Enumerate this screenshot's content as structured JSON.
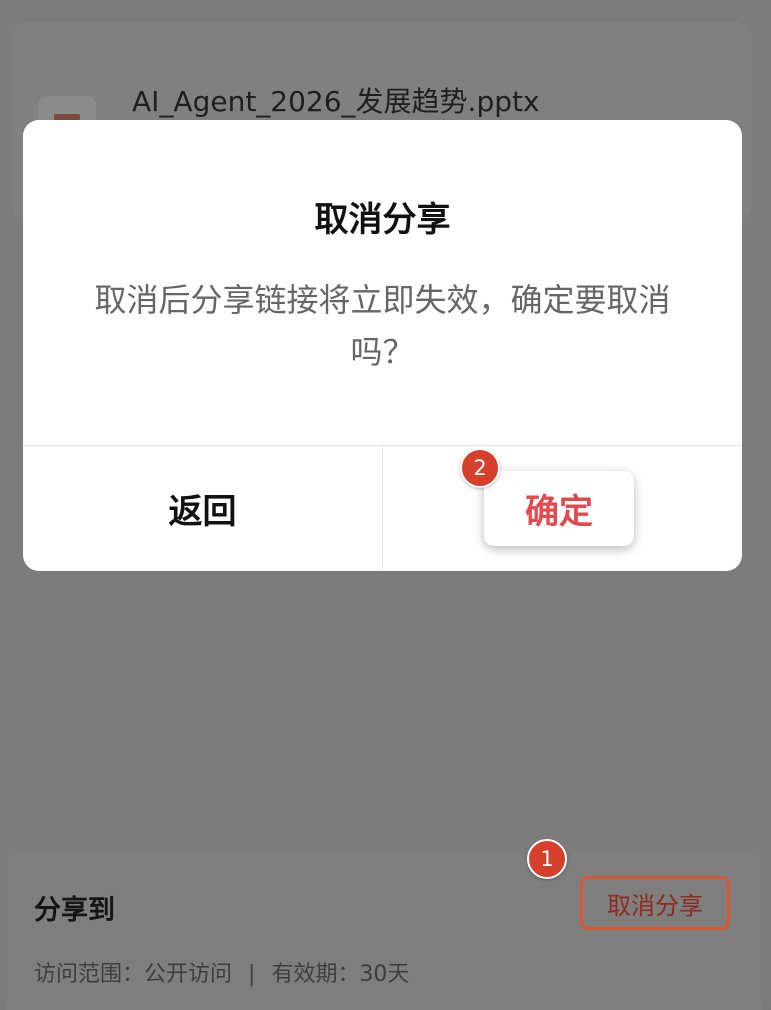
{
  "background": {
    "file_name": "AI_Agent_2026_发展趋势.pptx",
    "share_panel": {
      "title": "分享到",
      "access_scope": "访问范围：公开访问",
      "separator": "|",
      "validity": "有效期：30天",
      "cancel_share_button": "取消分享"
    }
  },
  "dialog": {
    "title": "取消分享",
    "message": "取消后分享链接将立即失效，确定要取消吗？",
    "back_button": "返回",
    "confirm_button": "确定"
  },
  "step_badges": [
    "1",
    "2"
  ],
  "colors": {
    "accent_red": "#e24a4f",
    "badge_red": "#d63f2c",
    "highlight_border": "#d8572e"
  }
}
